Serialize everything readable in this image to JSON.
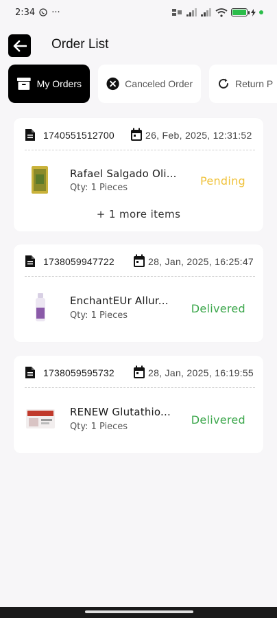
{
  "status_bar": {
    "time": "2:34",
    "more": "···"
  },
  "header": {
    "title": "Order List"
  },
  "tabs": [
    {
      "label": "My Orders",
      "active": true,
      "icon": "archive-icon"
    },
    {
      "label": "Canceled Order",
      "active": false,
      "icon": "cancel-icon"
    },
    {
      "label": "Return P",
      "active": false,
      "icon": "refresh-icon"
    }
  ],
  "orders": [
    {
      "id": "1740551512700",
      "date": "26, Feb, 2025, 12:31:52",
      "item_name": "Rafael Salgado Oli...",
      "qty": "Qty: 1 Pieces",
      "status": "Pending",
      "more": "+ 1 more items"
    },
    {
      "id": "1738059947722",
      "date": "28, Jan, 2025, 16:25:47",
      "item_name": "EnchantEUr Allur...",
      "qty": "Qty: 1 Pieces",
      "status": "Delivered"
    },
    {
      "id": "1738059595732",
      "date": "28, Jan, 2025, 16:19:55",
      "item_name": "RENEW Glutathio...",
      "qty": "Qty: 1 Pieces",
      "status": "Delivered"
    }
  ],
  "colors": {
    "pending": "#f0c23a",
    "delivered": "#3aa64a",
    "active_tab": "#000000",
    "background": "#f7f6f8"
  }
}
